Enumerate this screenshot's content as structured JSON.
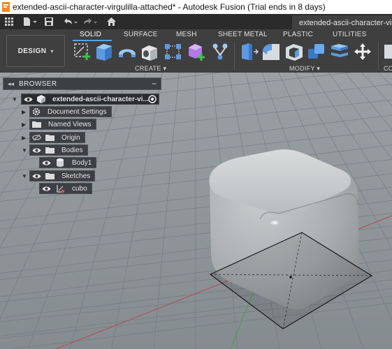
{
  "window": {
    "title": "extended-ascii-character-virgulilla-attached* - Autodesk Fusion (Trial ends in 8 days)"
  },
  "document_tab": {
    "label": "extended-ascii-character-virguli"
  },
  "ribbon": {
    "workspace": "DESIGN",
    "tabs": [
      "SOLID",
      "SURFACE",
      "MESH",
      "SHEET METAL",
      "PLASTIC",
      "UTILITIES"
    ],
    "active_tab": "SOLID",
    "groups": {
      "create": "CREATE ▾",
      "modify": "MODIFY ▾",
      "construct_partial": "CO"
    }
  },
  "browser": {
    "title": "BROWSER",
    "collapse_glyph": "◂◂",
    "minimize_glyph": "−",
    "root": "extended-ascii-character-vi...",
    "items": {
      "document_settings": "Document Settings",
      "named_views": "Named Views",
      "origin": "Origin",
      "bodies": "Bodies",
      "body1": "Body1",
      "sketches": "Sketches",
      "cubo": "cubo"
    }
  },
  "colors": {
    "ribbon_bg": "#3f3f3f",
    "accent_blue": "#5aa0e8",
    "brand_orange": "#f08a24"
  }
}
